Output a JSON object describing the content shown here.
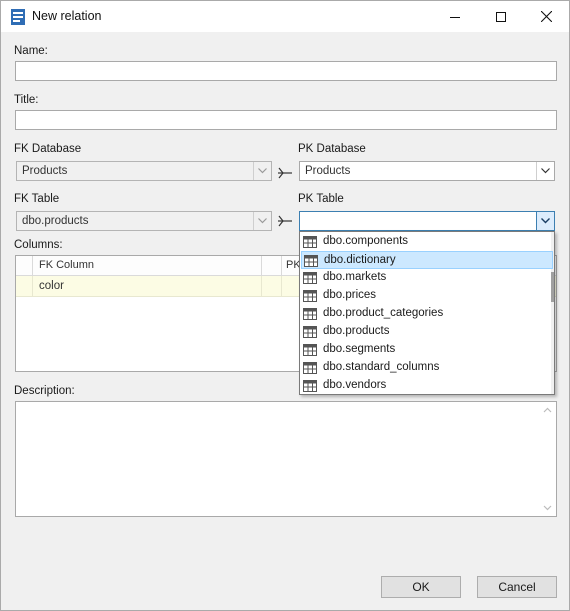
{
  "window": {
    "title": "New relation"
  },
  "form": {
    "name_label": "Name:",
    "name_value": "",
    "title_label": "Title:",
    "title_value": "",
    "fk_database_label": "FK Database",
    "fk_database_value": "Products",
    "pk_database_label": "PK Database",
    "pk_database_value": "Products",
    "fk_table_label": "FK Table",
    "fk_table_value": "dbo.products",
    "pk_table_label": "PK Table",
    "pk_table_value": "",
    "columns_label": "Columns:",
    "description_label": "Description:",
    "description_value": ""
  },
  "columns_grid": {
    "headers": [
      "FK Column",
      "PK"
    ],
    "rows": [
      {
        "fk_column": "color",
        "pk_column": ""
      }
    ]
  },
  "pk_table_dropdown": {
    "selected_index": 1,
    "options": [
      "dbo.components",
      "dbo.dictionary",
      "dbo.markets",
      "dbo.prices",
      "dbo.product_categories",
      "dbo.products",
      "dbo.segments",
      "dbo.standard_columns",
      "dbo.vendors"
    ]
  },
  "buttons": {
    "ok": "OK",
    "cancel": "Cancel"
  },
  "colors": {
    "selection": "#cce8ff",
    "selection_border": "#99d1ff",
    "grid_row": "#fcfce4",
    "dialog_bg": "#f0f0f0"
  }
}
